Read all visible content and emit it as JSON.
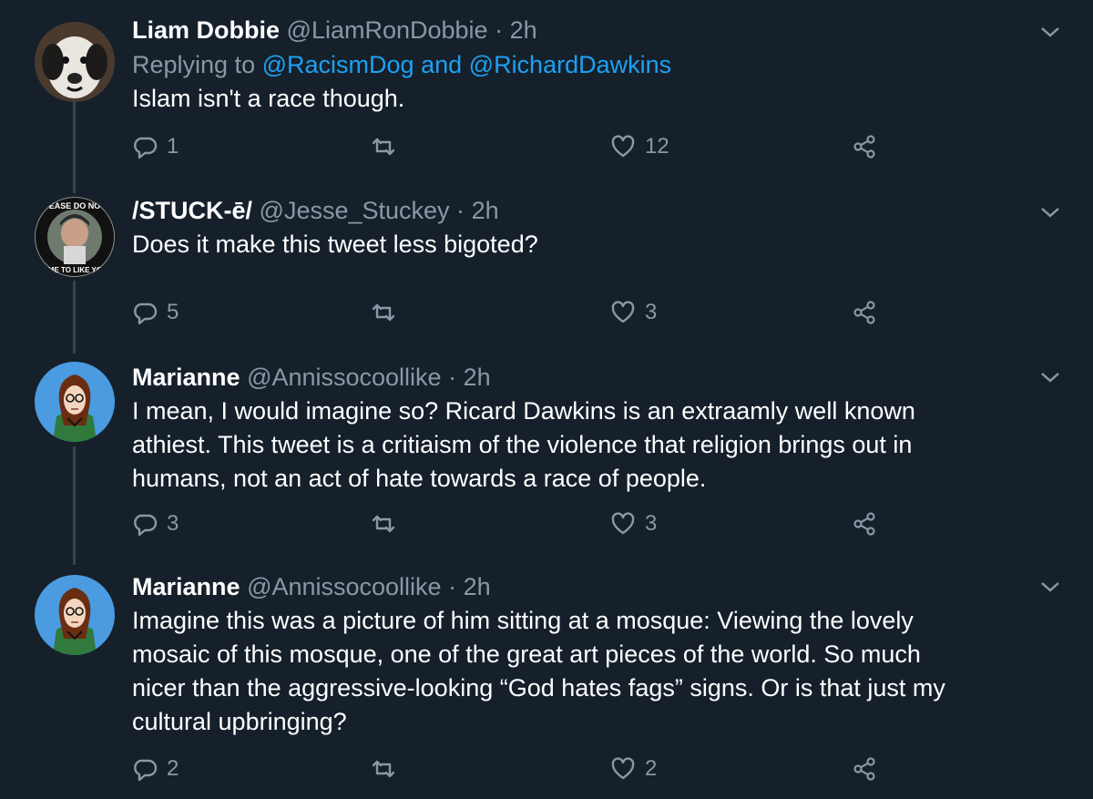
{
  "tweets": [
    {
      "name": "Liam Dobbie",
      "handle": "@LiamRonDobbie",
      "separator": "·",
      "time": "2h",
      "reply_prefix": "Replying to",
      "reply_mention_1": "@RacismDog",
      "reply_and": "and",
      "reply_mention_2": "@RichardDawkins",
      "lines": [
        "Islam isn't a race though."
      ],
      "replies": "1",
      "retweets": "",
      "likes": "12"
    },
    {
      "name": "/STUCK-ē/",
      "handle": "@Jesse_Stuckey",
      "separator": "·",
      "time": "2h",
      "avatar_text_top": "EASE DO NO",
      "avatar_text_bottom": "TE ME TO LIKE YOUR",
      "lines": [
        "Does it make this tweet less bigoted?"
      ],
      "replies": "5",
      "retweets": "",
      "likes": "3"
    },
    {
      "name": "Marianne",
      "handle": "@Annissocoollike",
      "separator": "·",
      "time": "2h",
      "lines": [
        "I mean, I would imagine so? Ricard Dawkins is an extraamly well known",
        "athiest. This tweet is a critiaism of the violence that religion brings out in",
        "humans, not an act of hate towards a race of people."
      ],
      "replies": "3",
      "retweets": "",
      "likes": "3"
    },
    {
      "name": "Marianne",
      "handle": "@Annissocoollike",
      "separator": "·",
      "time": "2h",
      "lines": [
        "Imagine this was a picture of him sitting at a mosque: Viewing the lovely",
        "mosaic of this mosque, one of the great art pieces of the world. So much",
        "nicer than the aggressive-looking “God hates fags” signs. Or is that just my",
        "cultural upbringing?"
      ],
      "replies": "2",
      "retweets": "",
      "likes": "2"
    }
  ],
  "icons": {
    "reply": "reply-icon",
    "retweet": "retweet-icon",
    "like": "heart-icon",
    "share": "share-icon",
    "more": "chevron-down-icon"
  },
  "colors": {
    "background": "#15202b",
    "secondary_text": "#8899a6",
    "link": "#1da1f2",
    "thread_line": "#38444d"
  }
}
